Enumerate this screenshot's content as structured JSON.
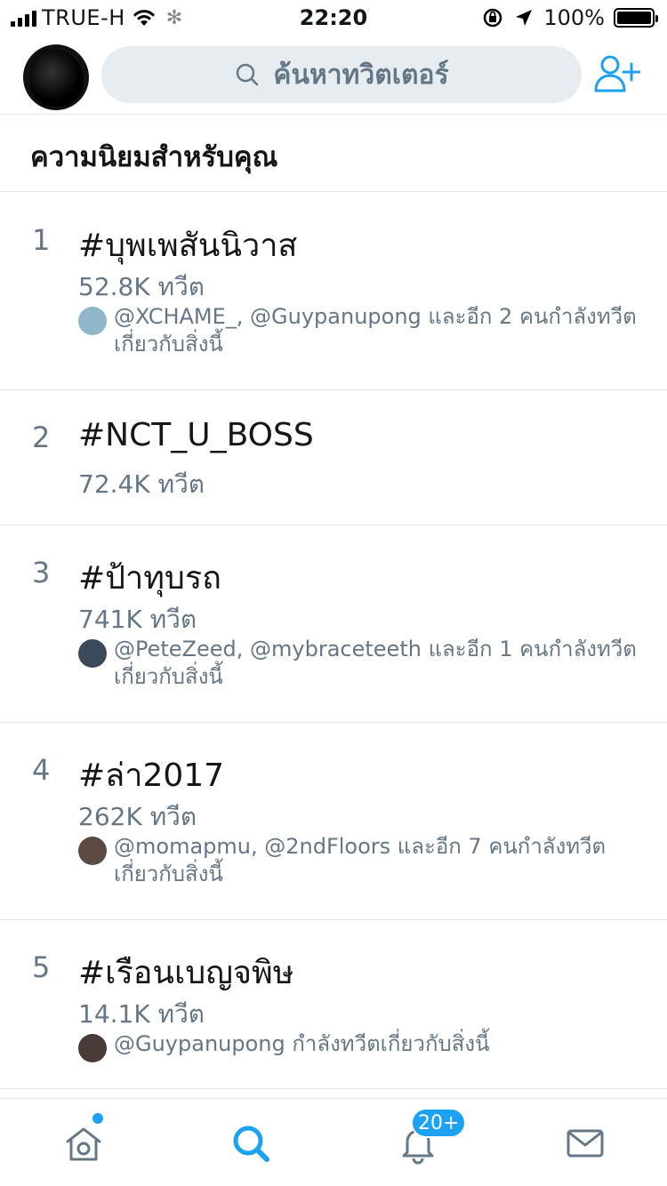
{
  "status_bar": {
    "carrier": "TRUE-H",
    "time": "22:20",
    "battery_percent": "100%",
    "battery_level": 1.0
  },
  "header": {
    "search_placeholder": "ค้นหาทวิตเตอร์",
    "search_icon": "search-icon",
    "add_user_icon": "add-user-icon"
  },
  "section": {
    "title": "ความนิยมสำหรับคุณ"
  },
  "trends": [
    {
      "rank": "1",
      "tag": "#บุพเพสันนิวาส",
      "count": "52.8K ทวีต",
      "context": "@XCHAME_, @Guypanupong และอีก 2 คนกำลังทวีตเกี่ยวกับสิ่งนี้",
      "avatar_color": "#8fb6c9"
    },
    {
      "rank": "2",
      "tag": "#NCT_U_BOSS",
      "count": "72.4K ทวีต",
      "context": null,
      "avatar_color": null
    },
    {
      "rank": "3",
      "tag": "#ป้าทุบรถ",
      "count": "741K ทวีต",
      "context": "@PeteZeed, @mybraceteeth และอีก 1 คนกำลังทวีตเกี่ยวกับสิ่งนี้",
      "avatar_color": "#3b4a5a"
    },
    {
      "rank": "4",
      "tag": "#ล่า2017",
      "count": "262K ทวีต",
      "context": "@momapmu, @2ndFloors และอีก 7 คนกำลังทวีตเกี่ยวกับสิ่งนี้",
      "avatar_color": "#5a4a42"
    },
    {
      "rank": "5",
      "tag": "#เรือนเบญจพิษ",
      "count": "14.1K ทวีต",
      "context": "@Guypanupong กำลังทวีตเกี่ยวกับสิ่งนี้",
      "avatar_color": "#4a3a38"
    }
  ],
  "tabbar": {
    "notifications_badge": "20+",
    "icons": [
      "home-icon",
      "search-icon",
      "bell-icon",
      "mail-icon"
    ]
  },
  "colors": {
    "accent": "#1da1f2",
    "secondary_text": "#657786",
    "divider": "#e1e8ed",
    "search_bg": "#e6ecf0"
  }
}
